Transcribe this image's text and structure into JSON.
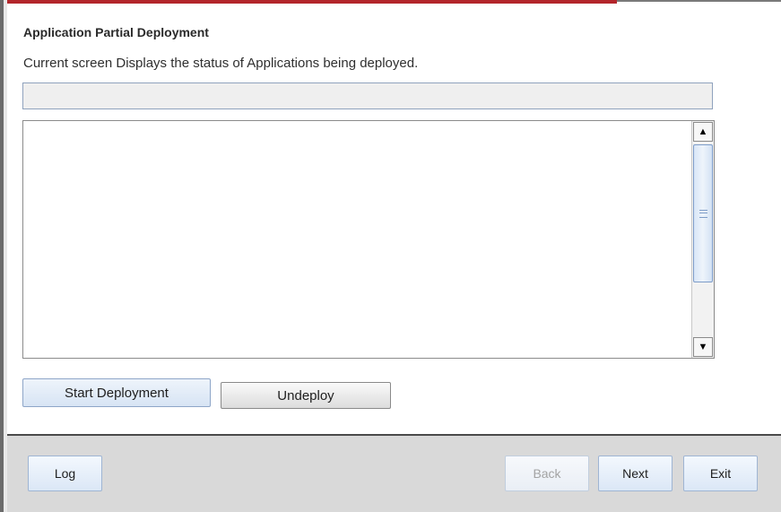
{
  "page": {
    "title": "Application Partial Deployment",
    "description": "Current screen Displays the status of Applications being deployed."
  },
  "progress": {
    "value": 0
  },
  "log": {
    "text": ""
  },
  "actions": {
    "start_label": "Start Deployment",
    "undeploy_label": "Undeploy"
  },
  "footer": {
    "log_label": "Log",
    "back_label": "Back",
    "next_label": "Next",
    "exit_label": "Exit"
  },
  "colors": {
    "accent": "#b3262b",
    "button_blue": "#dbe7f6",
    "footer_bg": "#d9d9d9"
  }
}
